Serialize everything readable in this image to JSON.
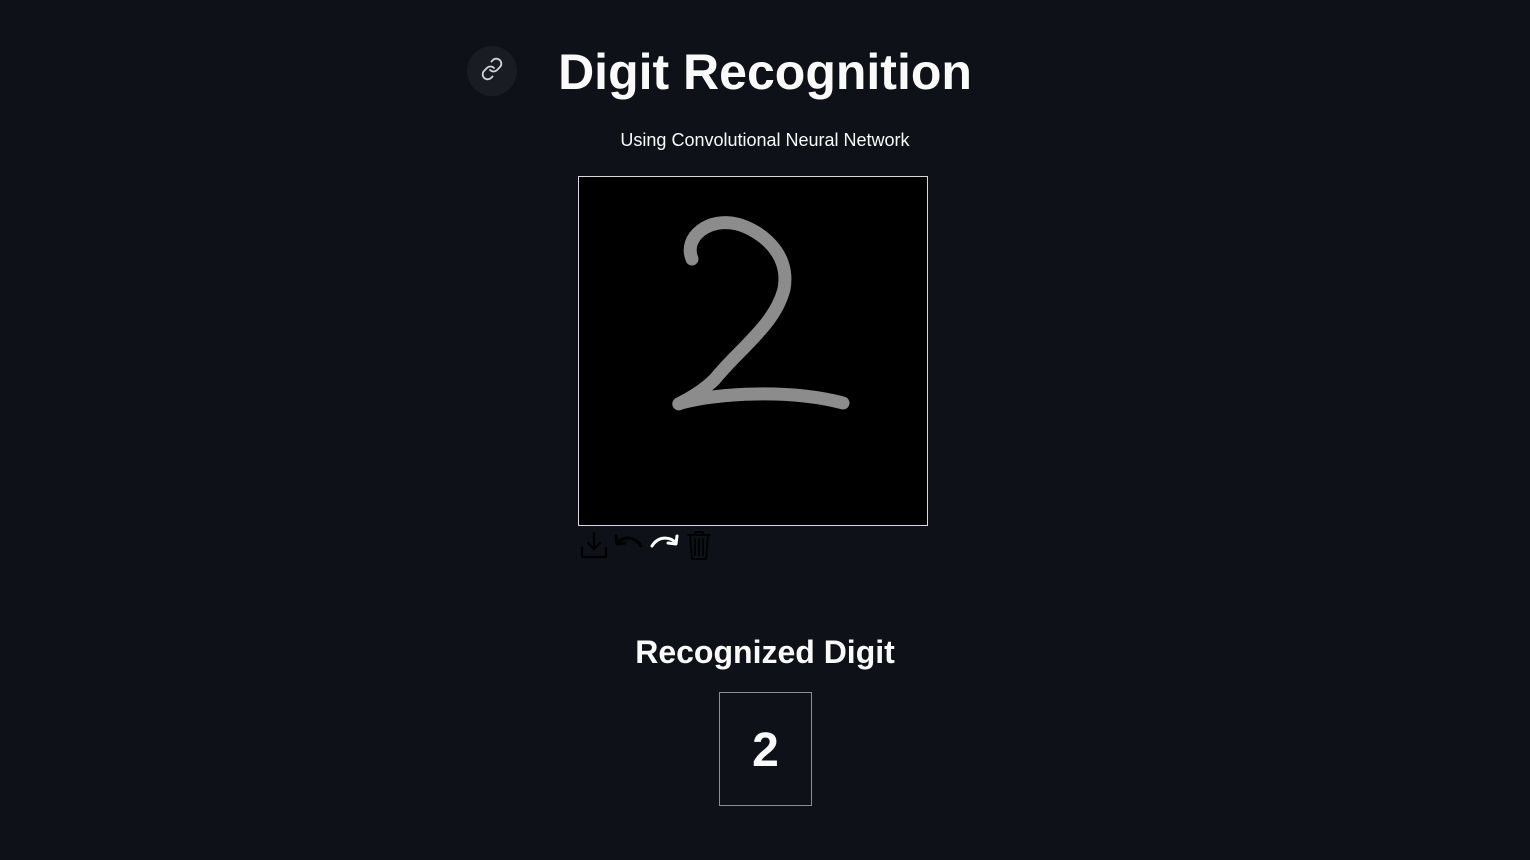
{
  "header": {
    "title": "Digit Recognition",
    "subtitle": "Using Convolutional Neural Network",
    "anchor_icon": "link-icon"
  },
  "canvas": {
    "background_color": "#000000",
    "stroke_color": "#8c8c8c",
    "toolbar": [
      {
        "icon": "download-icon"
      },
      {
        "icon": "undo-icon"
      },
      {
        "icon": "redo-icon"
      },
      {
        "icon": "trash-icon"
      }
    ]
  },
  "result": {
    "heading": "Recognized Digit",
    "digit": "2"
  },
  "colors": {
    "background": "#0e1117",
    "text": "#fafafa"
  }
}
